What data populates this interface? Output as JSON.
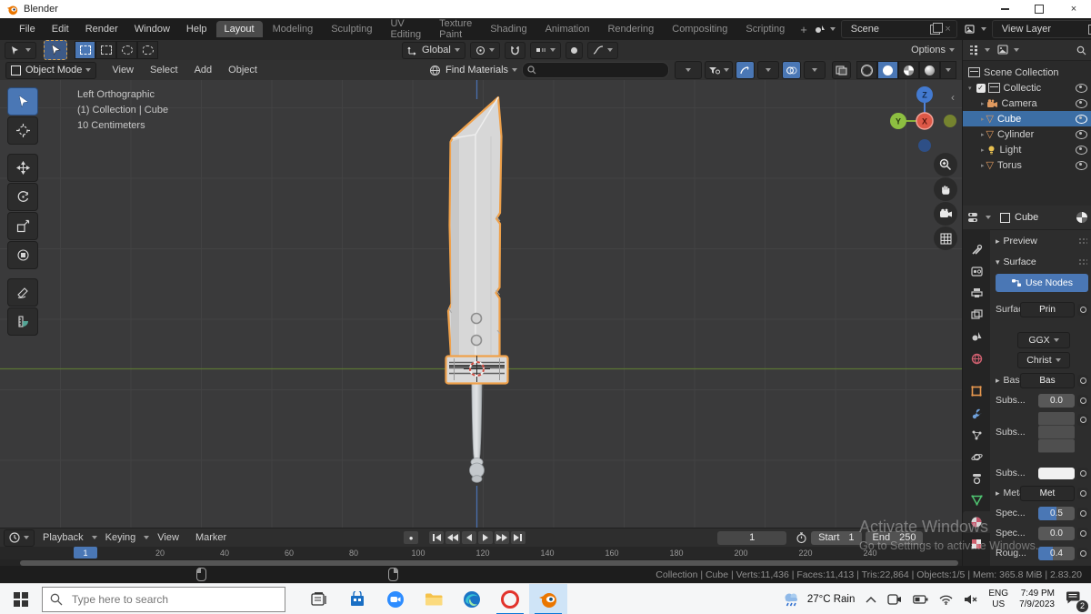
{
  "window": {
    "title": "Blender"
  },
  "icons": {
    "close": "×",
    "tri_open": "▾",
    "tri_closed": "▸",
    "check": "✓",
    "mesh_tri": "▽",
    "record": "●",
    "collapse": "‹",
    "plus": "+",
    "search_hint": ""
  },
  "topbar": {
    "menus": [
      "File",
      "Edit",
      "Render",
      "Window",
      "Help"
    ],
    "workspaces": [
      "Layout",
      "Modeling",
      "Sculpting",
      "UV Editing",
      "Texture Paint",
      "Shading",
      "Animation",
      "Rendering",
      "Compositing",
      "Scripting"
    ],
    "add_workspace": "+",
    "scene_label": "Scene",
    "view_layer_label": "View Layer"
  },
  "tool_settings": {
    "orientation": "Global",
    "options_label": "Options"
  },
  "viewport_header": {
    "mode": "Object Mode",
    "menus": [
      "View",
      "Select",
      "Add",
      "Object"
    ],
    "search_label": "Find Materials"
  },
  "viewport": {
    "overlay": [
      "Left Orthographic",
      "(1) Collection | Cube",
      "10 Centimeters"
    ],
    "axis": {
      "x": "X",
      "y": "Y",
      "z": "Z"
    }
  },
  "outliner": {
    "root": "Scene Collection",
    "collection": "Collectic",
    "items": [
      "Camera",
      "Cube",
      "Cylinder",
      "Light",
      "Torus"
    ],
    "selected": "Cube"
  },
  "properties": {
    "breadcrumb": "Cube",
    "preview_panel": "Preview",
    "surface_panel": "Surface",
    "use_nodes": "Use Nodes",
    "surface_label": "Surface",
    "surface_value": "Prin",
    "distribution": "GGX",
    "subsurface_method": "Christ",
    "fields": [
      {
        "label": "Base ...",
        "value": "Bas"
      },
      {
        "label": "Subs...",
        "value": "0.0"
      },
      {
        "label": "Subs...",
        "value": ""
      },
      {
        "label": "Subs...",
        "value": ""
      },
      {
        "label": "Metal...",
        "value": "Met"
      },
      {
        "label": "Spec...",
        "value": "0.5"
      },
      {
        "label": "Spec...",
        "value": "0.0"
      },
      {
        "label": "Roug...",
        "value": "0.4"
      }
    ]
  },
  "timeline": {
    "menus": [
      "Playback",
      "Keying",
      "View",
      "Marker"
    ],
    "current_frame": "1",
    "start_label": "Start",
    "start_value": "1",
    "end_label": "End",
    "end_value": "250",
    "playhead": "1",
    "ticks": [
      "20",
      "40",
      "60",
      "80",
      "100",
      "120",
      "140",
      "160",
      "180",
      "200",
      "220",
      "240"
    ]
  },
  "status_bar": {
    "info": "Collection | Cube | Verts:11,436 | Faces:11,413 | Tris:22,864 | Objects:1/5 | Mem: 365.8 MiB | 2.83.20"
  },
  "watermark": {
    "line1": "Activate Windows",
    "line2": "Go to Settings to activate Windows."
  },
  "taskbar": {
    "search_placeholder": "Type here to search",
    "weather": "27°C Rain",
    "lang_line1": "ENG",
    "lang_line2": "US",
    "time": "7:49 PM",
    "date": "7/9/2023",
    "notification_count": "2"
  },
  "colors": {
    "accent_blue": "#4a77b5",
    "selection_orange": "#efa14b",
    "viewport_bg": "#3a3a3b"
  }
}
